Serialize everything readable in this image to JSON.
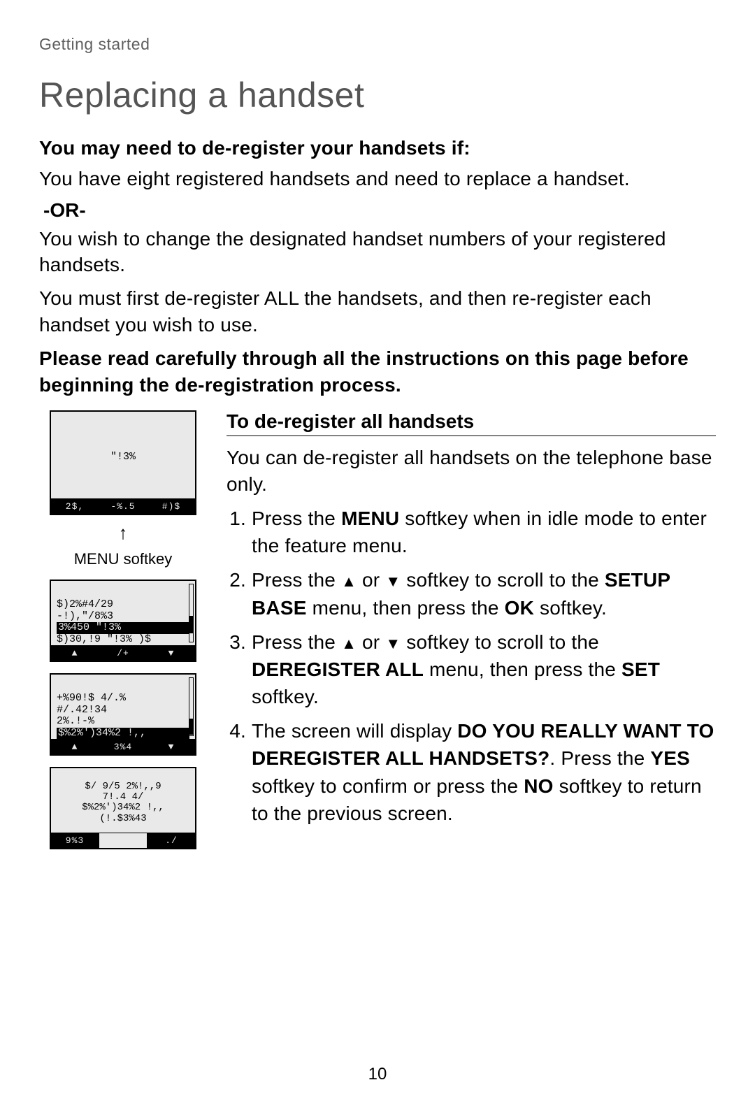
{
  "breadcrumb": "Getting started",
  "page_title": "Replacing a handset",
  "intro": {
    "lead_bold": "You may need to de-register your handsets if:",
    "para1": "You have eight registered handsets and need to replace a handset.",
    "or_label": "-OR-",
    "para2": "You wish to change the designated handset numbers of your registered handsets.",
    "para3": "You must first de-register ALL the handsets, and then re-register each handset you wish to use.",
    "warn_bold": "Please read carefully through all the instructions on this page before beginning the de-registration process."
  },
  "right": {
    "sub_heading": "To de-register all handsets",
    "lead": "You can de-register all handsets on the telephone base only.",
    "steps": [
      {
        "pre": "Press the ",
        "b1": "MENU",
        "post": " softkey when in idle mode to enter the feature menu."
      },
      {
        "pre": "Press the ",
        "tri_up": "▲",
        "mid": " or ",
        "tri_down": "▼",
        "post": " softkey to scroll to the ",
        "b1": "SETUP BASE",
        "post2": " menu, then press the ",
        "b2": "OK",
        "post3": " softkey."
      },
      {
        "pre": "Press the ",
        "tri_up": "▲",
        "mid": " or ",
        "tri_down": "▼",
        "post": " softkey to scroll to the ",
        "b1": "DEREGISTER ALL",
        "post2": " menu, then press the ",
        "b2": "SET",
        "post3": " softkey."
      },
      {
        "pre": "The screen will display ",
        "b1": "DO YOU REALLY WANT TO DEREGISTER ALL HANDSETS?",
        "post": ". Press the ",
        "b2": "YES",
        "post2": " softkey to confirm or press the ",
        "b3": "NO",
        "post3": " softkey to return to the previous screen."
      }
    ]
  },
  "screens": {
    "s1": {
      "center": "\"!3%",
      "soft": [
        "2$,",
        "-%.5",
        "#)$"
      ],
      "caption_arrow": "↑",
      "caption": "MENU softkey"
    },
    "s2": {
      "lines": [
        "$)2%#4/29",
        "-!),\"/8%3"
      ],
      "inv": "3%450 \"!3%    ",
      "after": "$)30,!9 \"!3% )$",
      "soft_left": "▲",
      "soft_mid": "/+",
      "soft_right": "▼",
      "thumb_top": "55%",
      "thumb_h": "30%"
    },
    "s3": {
      "lines": [
        "+%90!$ 4/.%",
        "#/.42!34",
        "2%.!-%"
      ],
      "inv": "$%2%')34%2 !,,",
      "soft_left": "▲",
      "soft_mid": "3%4",
      "soft_right": "▼",
      "thumb_top": "70%",
      "thumb_h": "28%"
    },
    "s4": {
      "lines": [
        "$/ 9/5 2%!,,9",
        "7!.4 4/",
        "$%2%')34%2 !,,",
        "(!.$3%43"
      ],
      "soft_left": "9%3",
      "soft_mid": "",
      "soft_right": "./"
    }
  },
  "pagenum": "10"
}
